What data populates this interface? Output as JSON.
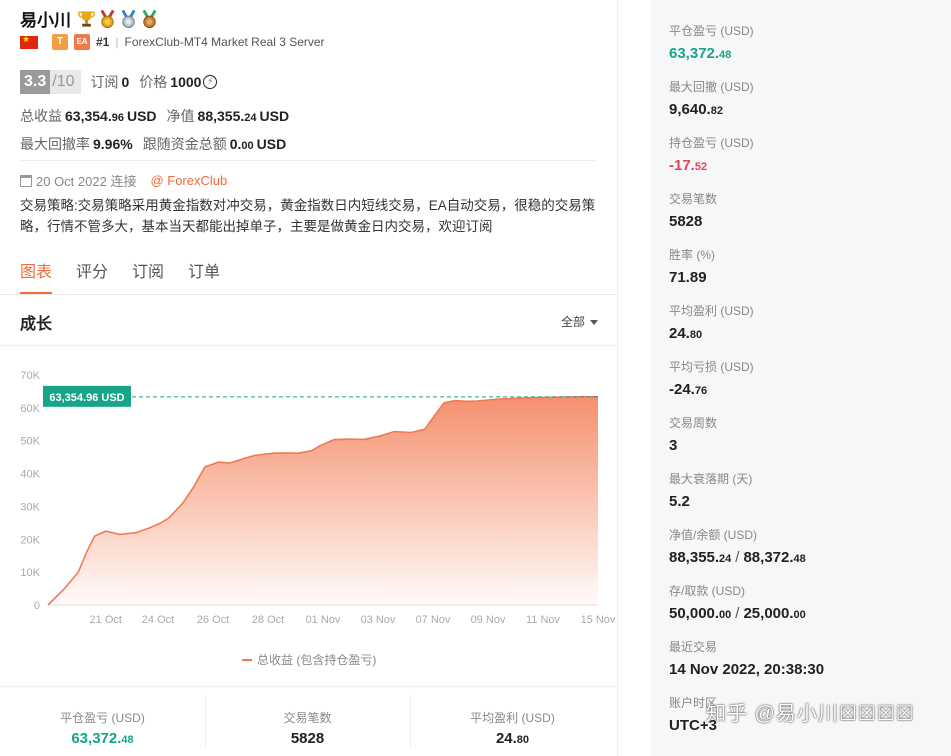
{
  "trader": {
    "name": "易小川",
    "medals": [
      "trophy-icon",
      "gold-medal-icon",
      "silver-medal-icon",
      "bronze-medal-icon"
    ],
    "flag": "china-flag-icon",
    "tag_t": "T",
    "tag_ea": "EA",
    "rank": "#1",
    "server": "ForexClub-MT4 Market Real 3 Server"
  },
  "score": {
    "value": "3.3",
    "max": "/10",
    "subscribe_label": "订阅",
    "subscribe_value": "0",
    "price_label": "价格",
    "price_value": "1000",
    "coin_symbol": "⚡"
  },
  "stats": {
    "total_profit_label": "总收益",
    "total_profit_main": "63,354.",
    "total_profit_dec": "96",
    "total_profit_unit": "USD",
    "equity_label": "净值",
    "equity_main": "88,355.",
    "equity_dec": "24",
    "equity_unit": "USD",
    "drawdown_label": "最大回撤率",
    "drawdown_value": "9.96%",
    "follow_label": "跟随资金总额",
    "follow_main": "0.",
    "follow_dec": "00",
    "follow_unit": "USD"
  },
  "connect": {
    "date": "20 Oct 2022 连接",
    "broker": "@ ForexClub"
  },
  "strategy": "交易策略:交易策略采用黄金指数对冲交易，黄金指数日内短线交易，EA自动交易，很稳的交易策略，行情不管多大，基本当天都能出掉单子，主要是做黄金日内交易，欢迎订阅",
  "tabs": [
    "图表",
    "评分",
    "订阅",
    "订单"
  ],
  "section": {
    "title": "成长",
    "range": "全部"
  },
  "colors": {
    "accent": "#f26b3a",
    "green": "#17a589",
    "red": "#e0455a",
    "area_top": "#f58a66",
    "line": "#f07a55",
    "marker": "#17a589"
  },
  "chart_data": {
    "type": "area",
    "x": [
      "19 Oct",
      "19 Oct",
      "20 Oct",
      "20 Oct",
      "21 Oct",
      "21 Oct",
      "22 Oct",
      "23 Oct",
      "24 Oct",
      "24 Oct",
      "25 Oct",
      "25 Oct",
      "25 Oct",
      "26 Oct",
      "26 Oct",
      "27 Oct",
      "27 Oct",
      "28 Oct",
      "28 Oct",
      "29 Oct",
      "30 Oct",
      "31 Oct",
      "01 Nov",
      "01 Nov",
      "02 Nov",
      "02 Nov",
      "03 Nov",
      "03 Nov",
      "04 Nov",
      "05 Nov",
      "06 Nov",
      "07 Nov",
      "07 Nov",
      "08 Nov",
      "08 Nov",
      "09 Nov",
      "09 Nov",
      "10 Nov",
      "11 Nov",
      "12 Nov",
      "13 Nov",
      "14 Nov",
      "15 Nov"
    ],
    "x_ticks": [
      "21 Oct",
      "24 Oct",
      "26 Oct",
      "28 Oct",
      "01 Nov",
      "03 Nov",
      "07 Nov",
      "09 Nov",
      "11 Nov",
      "15 Nov"
    ],
    "x_tick_pos": [
      0.105,
      0.2,
      0.3,
      0.4,
      0.5,
      0.6,
      0.7,
      0.8,
      0.9,
      1.0
    ],
    "xn": [
      0.0,
      0.03,
      0.055,
      0.07,
      0.085,
      0.105,
      0.13,
      0.16,
      0.185,
      0.205,
      0.22,
      0.245,
      0.265,
      0.285,
      0.31,
      0.33,
      0.355,
      0.375,
      0.41,
      0.435,
      0.455,
      0.48,
      0.495,
      0.52,
      0.545,
      0.575,
      0.605,
      0.63,
      0.66,
      0.685,
      0.7,
      0.72,
      0.74,
      0.76,
      0.78,
      0.8,
      0.82,
      0.85,
      0.88,
      0.91,
      0.94,
      0.97,
      1.0
    ],
    "series": [
      {
        "values": [
          0,
          5000,
          10000,
          16000,
          21000,
          22500,
          21500,
          22000,
          23500,
          25000,
          26500,
          31000,
          36000,
          42000,
          43500,
          43200,
          44500,
          45500,
          46200,
          46300,
          46200,
          47000,
          48500,
          50300,
          50500,
          50400,
          51500,
          52800,
          52500,
          53500,
          57000,
          61500,
          62200,
          62000,
          62100,
          62400,
          62700,
          62900,
          63100,
          63200,
          63300,
          63350,
          63354.96
        ]
      }
    ],
    "annotation": "63,354.96 USD",
    "reference_line": 63354.96,
    "yticks": [
      "0",
      "10K",
      "20K",
      "30K",
      "40K",
      "50K",
      "60K",
      "70K"
    ],
    "ylim": [
      0,
      70000
    ],
    "legend": "总收益 (包含持仓盈亏)",
    "legend_position": "bottom",
    "grid": false
  },
  "bottom": [
    {
      "label": "平仓盈亏 (USD)",
      "main": "63,372.",
      "dec": "48",
      "color": "green"
    },
    {
      "label": "交易笔数",
      "main": "5828",
      "dec": "",
      "color": "normal"
    },
    {
      "label": "平均盈利 (USD)",
      "main": "24.",
      "dec": "80",
      "color": "normal"
    }
  ],
  "right_stats": [
    {
      "label": "平仓盈亏 (USD)",
      "main": "63,372.",
      "dec": "48",
      "color": "green"
    },
    {
      "label": "最大回撤 (USD)",
      "main": "9,640.",
      "dec": "82",
      "color": "normal"
    },
    {
      "label": "持仓盈亏 (USD)",
      "main": "-17.",
      "dec": "52",
      "color": "red"
    },
    {
      "label": "交易笔数",
      "main": "5828",
      "dec": "",
      "color": "normal"
    },
    {
      "label": "胜率 (%)",
      "main": "71.89",
      "dec": "",
      "color": "normal"
    },
    {
      "label": "平均盈利 (USD)",
      "main": "24.",
      "dec": "80",
      "color": "normal"
    },
    {
      "label": "平均亏损 (USD)",
      "main": "-24.",
      "dec": "76",
      "color": "normal"
    },
    {
      "label": "交易周数",
      "main": "3",
      "dec": "",
      "color": "normal"
    },
    {
      "label": "最大衰落期 (天)",
      "main": "5.2",
      "dec": "",
      "color": "normal"
    },
    {
      "label": "净值/余额 (USD)",
      "main": "88,355.",
      "dec": "24",
      "main2": "88,372.",
      "dec2": "48",
      "color": "normal"
    },
    {
      "label": "存/取款 (USD)",
      "main": "50,000.",
      "dec": "00",
      "main2": "25,000.",
      "dec2": "00",
      "color": "normal"
    },
    {
      "label": "最近交易",
      "main": "14 Nov 2022, 20:38:30",
      "dec": "",
      "color": "normal"
    },
    {
      "label": "账户时区",
      "main": "UTC+3",
      "dec": "",
      "color": "normal"
    }
  ],
  "watermark": "知乎 @易小川☒☒☒☒"
}
